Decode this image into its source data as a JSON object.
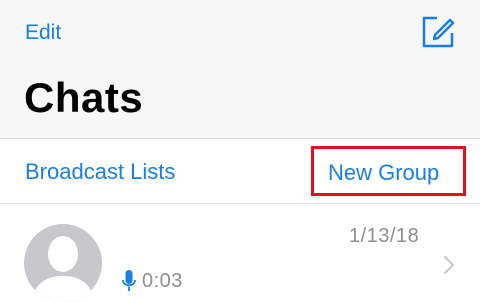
{
  "colors": {
    "accent": "#1a7ee8",
    "highlight_box": "#d9141e",
    "header_bg": "#f7f7f7",
    "secondary_text": "#8e8e93",
    "avatar_bg": "#c7c7cc"
  },
  "nav": {
    "edit_label": "Edit",
    "compose_icon": "compose-icon",
    "title": "Chats"
  },
  "subnav": {
    "broadcast_label": "Broadcast Lists",
    "new_group_label": "New Group"
  },
  "chats": [
    {
      "avatar_icon": "default-person-avatar",
      "date": "1/13/18",
      "preview_icon": "microphone-icon",
      "preview_text": "0:03",
      "chevron_icon": "chevron-right-icon"
    }
  ]
}
